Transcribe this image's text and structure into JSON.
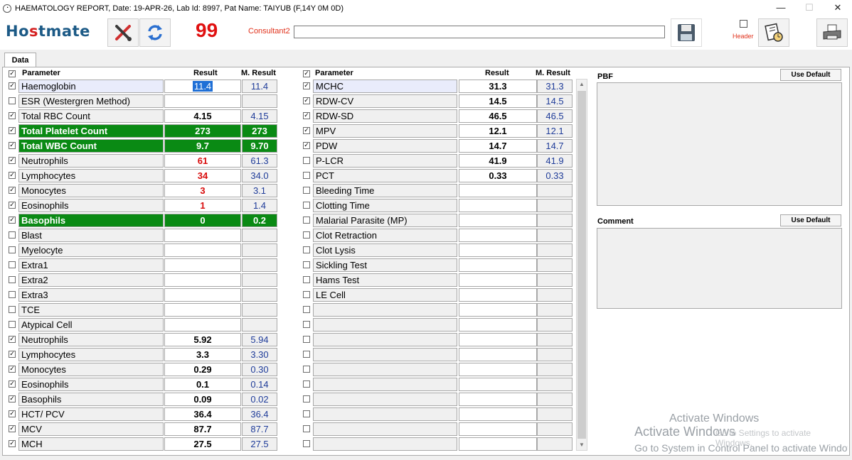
{
  "window": {
    "title": "HAEMATOLOGY REPORT, Date: 19-APR-26, Lab Id: 8997, Pat Name: TAIYUB (F,14Y 0M 0D)",
    "minimize": "—",
    "maximize": "☐",
    "close": "✕"
  },
  "toolbar": {
    "logo_a": "Ho",
    "logo_s": "s",
    "logo_b": "tmate",
    "count": "99",
    "consultant_label": "Consultant2",
    "consultant_value": "",
    "header_label": "Header"
  },
  "tabs": [
    "Data"
  ],
  "columns": {
    "parameter": "Parameter",
    "result": "Result",
    "mresult": "M. Result"
  },
  "left_rows": [
    {
      "checked": true,
      "name": "Haemoglobin",
      "result": "11.4",
      "mresult": "11.4",
      "style": "selected"
    },
    {
      "checked": false,
      "name": "ESR (Westergren Method)",
      "result": "",
      "mresult": "",
      "style": ""
    },
    {
      "checked": true,
      "name": "Total RBC Count",
      "result": "4.15",
      "mresult": "4.15",
      "style": ""
    },
    {
      "checked": true,
      "name": "Total Platelet Count",
      "result": "273",
      "mresult": "273",
      "style": "green"
    },
    {
      "checked": true,
      "name": "Total WBC Count",
      "result": "9.7",
      "mresult": "9.70",
      "style": "green"
    },
    {
      "checked": true,
      "name": "Neutrophils",
      "result": "61",
      "mresult": "61.3",
      "style": "red"
    },
    {
      "checked": true,
      "name": "Lymphocytes",
      "result": "34",
      "mresult": "34.0",
      "style": "red"
    },
    {
      "checked": true,
      "name": "Monocytes",
      "result": "3",
      "mresult": "3.1",
      "style": "red"
    },
    {
      "checked": true,
      "name": "Eosinophils",
      "result": "1",
      "mresult": "1.4",
      "style": "red"
    },
    {
      "checked": true,
      "name": "Basophils",
      "result": "0",
      "mresult": "0.2",
      "style": "green"
    },
    {
      "checked": false,
      "name": "Blast",
      "result": "",
      "mresult": "",
      "style": ""
    },
    {
      "checked": false,
      "name": "Myelocyte",
      "result": "",
      "mresult": "",
      "style": ""
    },
    {
      "checked": false,
      "name": "Extra1",
      "result": "",
      "mresult": "",
      "style": ""
    },
    {
      "checked": false,
      "name": "Extra2",
      "result": "",
      "mresult": "",
      "style": ""
    },
    {
      "checked": false,
      "name": "Extra3",
      "result": "",
      "mresult": "",
      "style": ""
    },
    {
      "checked": false,
      "name": "TCE",
      "result": "",
      "mresult": "",
      "style": ""
    },
    {
      "checked": false,
      "name": "Atypical Cell",
      "result": "",
      "mresult": "",
      "style": ""
    },
    {
      "checked": true,
      "name": "Neutrophils",
      "result": "5.92",
      "mresult": "5.94",
      "style": ""
    },
    {
      "checked": true,
      "name": "Lymphocytes",
      "result": "3.3",
      "mresult": "3.30",
      "style": ""
    },
    {
      "checked": true,
      "name": "Monocytes",
      "result": "0.29",
      "mresult": "0.30",
      "style": ""
    },
    {
      "checked": true,
      "name": "Eosinophils",
      "result": "0.1",
      "mresult": "0.14",
      "style": ""
    },
    {
      "checked": true,
      "name": "Basophils",
      "result": "0.09",
      "mresult": "0.02",
      "style": ""
    },
    {
      "checked": true,
      "name": "HCT/ PCV",
      "result": "36.4",
      "mresult": "36.4",
      "style": ""
    },
    {
      "checked": true,
      "name": "MCV",
      "result": "87.7",
      "mresult": "87.7",
      "style": ""
    },
    {
      "checked": true,
      "name": "MCH",
      "result": "27.5",
      "mresult": "27.5",
      "style": ""
    }
  ],
  "right_rows": [
    {
      "checked": true,
      "name": "MCHC",
      "result": "31.3",
      "mresult": "31.3",
      "style": "hl"
    },
    {
      "checked": true,
      "name": "RDW-CV",
      "result": "14.5",
      "mresult": "14.5",
      "style": ""
    },
    {
      "checked": true,
      "name": "RDW-SD",
      "result": "46.5",
      "mresult": "46.5",
      "style": ""
    },
    {
      "checked": true,
      "name": "MPV",
      "result": "12.1",
      "mresult": "12.1",
      "style": ""
    },
    {
      "checked": true,
      "name": "PDW",
      "result": "14.7",
      "mresult": "14.7",
      "style": ""
    },
    {
      "checked": false,
      "name": "P-LCR",
      "result": "41.9",
      "mresult": "41.9",
      "style": ""
    },
    {
      "checked": false,
      "name": "PCT",
      "result": "0.33",
      "mresult": "0.33",
      "style": ""
    },
    {
      "checked": false,
      "name": "Bleeding Time",
      "result": "",
      "mresult": "",
      "style": ""
    },
    {
      "checked": false,
      "name": "Clotting Time",
      "result": "",
      "mresult": "",
      "style": ""
    },
    {
      "checked": false,
      "name": "Malarial Parasite (MP)",
      "result": "",
      "mresult": "",
      "style": ""
    },
    {
      "checked": false,
      "name": "Clot Retraction",
      "result": "",
      "mresult": "",
      "style": ""
    },
    {
      "checked": false,
      "name": "Clot Lysis",
      "result": "",
      "mresult": "",
      "style": ""
    },
    {
      "checked": false,
      "name": "Sickling Test",
      "result": "",
      "mresult": "",
      "style": ""
    },
    {
      "checked": false,
      "name": "Hams Test",
      "result": "",
      "mresult": "",
      "style": ""
    },
    {
      "checked": false,
      "name": "LE Cell",
      "result": "",
      "mresult": "",
      "style": ""
    },
    {
      "checked": false,
      "name": "",
      "result": "",
      "mresult": "",
      "style": ""
    },
    {
      "checked": false,
      "name": "",
      "result": "",
      "mresult": "",
      "style": ""
    },
    {
      "checked": false,
      "name": "",
      "result": "",
      "mresult": "",
      "style": ""
    },
    {
      "checked": false,
      "name": "",
      "result": "",
      "mresult": "",
      "style": ""
    },
    {
      "checked": false,
      "name": "",
      "result": "",
      "mresult": "",
      "style": ""
    },
    {
      "checked": false,
      "name": "",
      "result": "",
      "mresult": "",
      "style": ""
    },
    {
      "checked": false,
      "name": "",
      "result": "",
      "mresult": "",
      "style": ""
    },
    {
      "checked": false,
      "name": "",
      "result": "",
      "mresult": "",
      "style": ""
    },
    {
      "checked": false,
      "name": "",
      "result": "",
      "mresult": "",
      "style": ""
    },
    {
      "checked": false,
      "name": "",
      "result": "",
      "mresult": "",
      "style": ""
    }
  ],
  "side": {
    "pbf_label": "PBF",
    "pbf_default": "Use Default",
    "pbf_value": "",
    "comment_label": "Comment",
    "comment_default": "Use Default",
    "comment_value": ""
  },
  "watermark": {
    "line1": "Activate Windows",
    "line2": "Activate Windows",
    "line2b": "Go to Settings to activate Windows.",
    "line3": "Go to System in Control Panel to activate Windows."
  },
  "colors": {
    "green_row": "#0a8a14",
    "red_value": "#d80c0c",
    "mresult_text": "#1f3c99",
    "logo": "#1c5a86"
  }
}
